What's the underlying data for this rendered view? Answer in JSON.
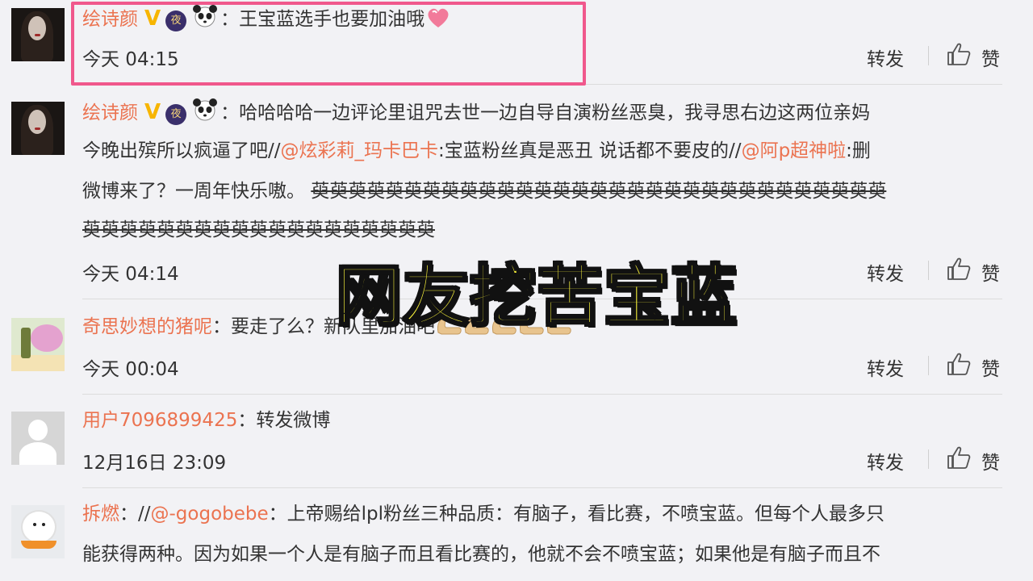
{
  "overlay": {
    "title": "网友挖苦宝蓝"
  },
  "actions": {
    "forward": "转发",
    "like": "赞"
  },
  "comments": [
    {
      "author": "绘诗颜",
      "verified": "V",
      "badge": "夜",
      "separator": "：",
      "text_line1": "王宝蓝选手也要加油哦",
      "time": "今天 04:15"
    },
    {
      "author": "绘诗颜",
      "verified": "V",
      "badge": "夜",
      "separator": "：",
      "l1": "哈哈哈哈一边评论里诅咒去世一边自导自演粉丝恶臭，我寻思右边这两位亲妈",
      "l2a": "今晚出殡所以疯逼了吧//",
      "l2b": "@炫彩莉_玛卡巴卡",
      "l2c": ":宝蓝粉丝真是恶丑  说话都不要皮的//",
      "l2d": "@阿p超神啦",
      "l2e": ":删",
      "l3a": "微博来了？一周年快乐嗷。 ",
      "l3b": "萸萸萸萸萸萸萸萸萸萸萸萸萸萸萸萸萸萸萸萸萸萸萸萸萸萸萸萸萸萸萸",
      "l4": "萸萸萸萸萸萸萸萸萸萸萸萸萸萸萸萸萸萸萸",
      "time": "今天 04:14"
    },
    {
      "author": "奇思妙想的猪呢",
      "separator": "：",
      "text": "要走了么？新队里加油吧",
      "time": "今天 00:04"
    },
    {
      "author": "用户7096899425",
      "separator": "：",
      "text": "转发微博",
      "time": "12月16日 23:09"
    },
    {
      "author": "拆燃",
      "separator": "：//",
      "mention": "@-gogobebe",
      "l1": "：上帝赐给lpl粉丝三种品质：有脑子，看比赛，不喷宝蓝。但每个人最多只",
      "l2": "能获得两种。因为如果一个人是有脑子而且看比赛的，他就不会不喷宝蓝；如果他是有脑子而且不"
    }
  ]
}
